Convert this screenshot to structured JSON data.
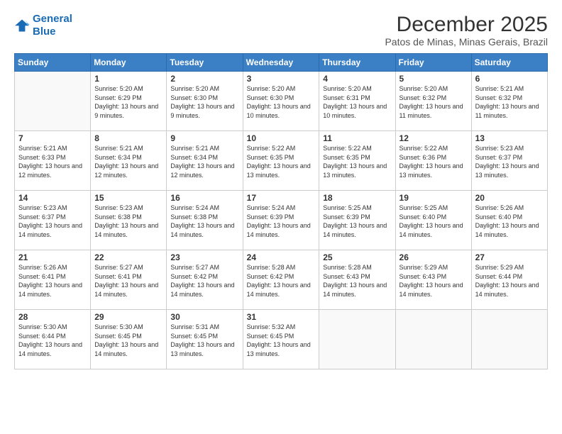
{
  "logo": {
    "line1": "General",
    "line2": "Blue"
  },
  "title": "December 2025",
  "subtitle": "Patos de Minas, Minas Gerais, Brazil",
  "headers": [
    "Sunday",
    "Monday",
    "Tuesday",
    "Wednesday",
    "Thursday",
    "Friday",
    "Saturday"
  ],
  "weeks": [
    [
      {
        "day": "",
        "sunrise": "",
        "sunset": "",
        "daylight": ""
      },
      {
        "day": "1",
        "sunrise": "Sunrise: 5:20 AM",
        "sunset": "Sunset: 6:29 PM",
        "daylight": "Daylight: 13 hours and 9 minutes."
      },
      {
        "day": "2",
        "sunrise": "Sunrise: 5:20 AM",
        "sunset": "Sunset: 6:30 PM",
        "daylight": "Daylight: 13 hours and 9 minutes."
      },
      {
        "day": "3",
        "sunrise": "Sunrise: 5:20 AM",
        "sunset": "Sunset: 6:30 PM",
        "daylight": "Daylight: 13 hours and 10 minutes."
      },
      {
        "day": "4",
        "sunrise": "Sunrise: 5:20 AM",
        "sunset": "Sunset: 6:31 PM",
        "daylight": "Daylight: 13 hours and 10 minutes."
      },
      {
        "day": "5",
        "sunrise": "Sunrise: 5:20 AM",
        "sunset": "Sunset: 6:32 PM",
        "daylight": "Daylight: 13 hours and 11 minutes."
      },
      {
        "day": "6",
        "sunrise": "Sunrise: 5:21 AM",
        "sunset": "Sunset: 6:32 PM",
        "daylight": "Daylight: 13 hours and 11 minutes."
      }
    ],
    [
      {
        "day": "7",
        "sunrise": "Sunrise: 5:21 AM",
        "sunset": "Sunset: 6:33 PM",
        "daylight": "Daylight: 13 hours and 12 minutes."
      },
      {
        "day": "8",
        "sunrise": "Sunrise: 5:21 AM",
        "sunset": "Sunset: 6:34 PM",
        "daylight": "Daylight: 13 hours and 12 minutes."
      },
      {
        "day": "9",
        "sunrise": "Sunrise: 5:21 AM",
        "sunset": "Sunset: 6:34 PM",
        "daylight": "Daylight: 13 hours and 12 minutes."
      },
      {
        "day": "10",
        "sunrise": "Sunrise: 5:22 AM",
        "sunset": "Sunset: 6:35 PM",
        "daylight": "Daylight: 13 hours and 13 minutes."
      },
      {
        "day": "11",
        "sunrise": "Sunrise: 5:22 AM",
        "sunset": "Sunset: 6:35 PM",
        "daylight": "Daylight: 13 hours and 13 minutes."
      },
      {
        "day": "12",
        "sunrise": "Sunrise: 5:22 AM",
        "sunset": "Sunset: 6:36 PM",
        "daylight": "Daylight: 13 hours and 13 minutes."
      },
      {
        "day": "13",
        "sunrise": "Sunrise: 5:23 AM",
        "sunset": "Sunset: 6:37 PM",
        "daylight": "Daylight: 13 hours and 13 minutes."
      }
    ],
    [
      {
        "day": "14",
        "sunrise": "Sunrise: 5:23 AM",
        "sunset": "Sunset: 6:37 PM",
        "daylight": "Daylight: 13 hours and 14 minutes."
      },
      {
        "day": "15",
        "sunrise": "Sunrise: 5:23 AM",
        "sunset": "Sunset: 6:38 PM",
        "daylight": "Daylight: 13 hours and 14 minutes."
      },
      {
        "day": "16",
        "sunrise": "Sunrise: 5:24 AM",
        "sunset": "Sunset: 6:38 PM",
        "daylight": "Daylight: 13 hours and 14 minutes."
      },
      {
        "day": "17",
        "sunrise": "Sunrise: 5:24 AM",
        "sunset": "Sunset: 6:39 PM",
        "daylight": "Daylight: 13 hours and 14 minutes."
      },
      {
        "day": "18",
        "sunrise": "Sunrise: 5:25 AM",
        "sunset": "Sunset: 6:39 PM",
        "daylight": "Daylight: 13 hours and 14 minutes."
      },
      {
        "day": "19",
        "sunrise": "Sunrise: 5:25 AM",
        "sunset": "Sunset: 6:40 PM",
        "daylight": "Daylight: 13 hours and 14 minutes."
      },
      {
        "day": "20",
        "sunrise": "Sunrise: 5:26 AM",
        "sunset": "Sunset: 6:40 PM",
        "daylight": "Daylight: 13 hours and 14 minutes."
      }
    ],
    [
      {
        "day": "21",
        "sunrise": "Sunrise: 5:26 AM",
        "sunset": "Sunset: 6:41 PM",
        "daylight": "Daylight: 13 hours and 14 minutes."
      },
      {
        "day": "22",
        "sunrise": "Sunrise: 5:27 AM",
        "sunset": "Sunset: 6:41 PM",
        "daylight": "Daylight: 13 hours and 14 minutes."
      },
      {
        "day": "23",
        "sunrise": "Sunrise: 5:27 AM",
        "sunset": "Sunset: 6:42 PM",
        "daylight": "Daylight: 13 hours and 14 minutes."
      },
      {
        "day": "24",
        "sunrise": "Sunrise: 5:28 AM",
        "sunset": "Sunset: 6:42 PM",
        "daylight": "Daylight: 13 hours and 14 minutes."
      },
      {
        "day": "25",
        "sunrise": "Sunrise: 5:28 AM",
        "sunset": "Sunset: 6:43 PM",
        "daylight": "Daylight: 13 hours and 14 minutes."
      },
      {
        "day": "26",
        "sunrise": "Sunrise: 5:29 AM",
        "sunset": "Sunset: 6:43 PM",
        "daylight": "Daylight: 13 hours and 14 minutes."
      },
      {
        "day": "27",
        "sunrise": "Sunrise: 5:29 AM",
        "sunset": "Sunset: 6:44 PM",
        "daylight": "Daylight: 13 hours and 14 minutes."
      }
    ],
    [
      {
        "day": "28",
        "sunrise": "Sunrise: 5:30 AM",
        "sunset": "Sunset: 6:44 PM",
        "daylight": "Daylight: 13 hours and 14 minutes."
      },
      {
        "day": "29",
        "sunrise": "Sunrise: 5:30 AM",
        "sunset": "Sunset: 6:45 PM",
        "daylight": "Daylight: 13 hours and 14 minutes."
      },
      {
        "day": "30",
        "sunrise": "Sunrise: 5:31 AM",
        "sunset": "Sunset: 6:45 PM",
        "daylight": "Daylight: 13 hours and 13 minutes."
      },
      {
        "day": "31",
        "sunrise": "Sunrise: 5:32 AM",
        "sunset": "Sunset: 6:45 PM",
        "daylight": "Daylight: 13 hours and 13 minutes."
      },
      {
        "day": "",
        "sunrise": "",
        "sunset": "",
        "daylight": ""
      },
      {
        "day": "",
        "sunrise": "",
        "sunset": "",
        "daylight": ""
      },
      {
        "day": "",
        "sunrise": "",
        "sunset": "",
        "daylight": ""
      }
    ]
  ]
}
